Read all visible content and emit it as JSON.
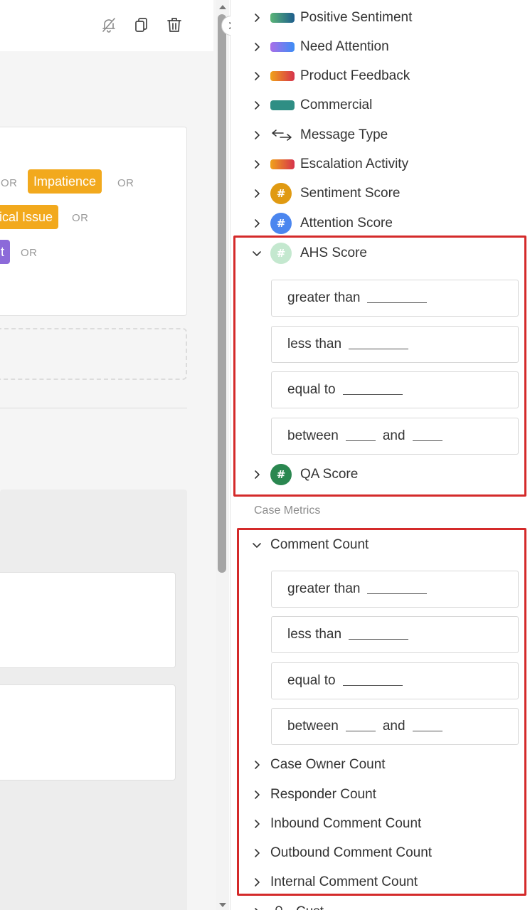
{
  "left": {
    "chips": {
      "impatience": "Impatience",
      "technical_issue": "ical Issue",
      "purple_partial": "t"
    },
    "or_label": "OR"
  },
  "attributes": [
    {
      "label": "Positive Sentiment",
      "indicator": "gradient-swatch",
      "colors": [
        "#5bb577",
        "#1d5d8c"
      ]
    },
    {
      "label": "Need Attention",
      "indicator": "gradient-swatch",
      "colors": [
        "#a96ee8",
        "#3d8df5"
      ]
    },
    {
      "label": "Product Feedback",
      "indicator": "gradient-swatch",
      "colors": [
        "#f0a21a",
        "#d6334c"
      ]
    },
    {
      "label": "Commercial",
      "indicator": "solid-swatch",
      "colors": [
        "#2f8e84",
        "#2f8e84"
      ]
    },
    {
      "label": "Message Type",
      "indicator": "arrows-icon"
    },
    {
      "label": "Escalation Activity",
      "indicator": "gradient-swatch",
      "colors": [
        "#f0a21a",
        "#d6334c"
      ]
    },
    {
      "label": "Sentiment Score",
      "indicator": "hash-badge",
      "color": "#e09a12"
    },
    {
      "label": "Attention Score",
      "indicator": "hash-badge",
      "color": "#4b86ef"
    },
    {
      "label": "AHS Score",
      "indicator": "hash-badge",
      "color": "#c4e8cf",
      "expanded": true
    },
    {
      "label": "QA Score",
      "indicator": "hash-badge",
      "color": "#2a8750"
    }
  ],
  "operators": {
    "greater_than": "greater than",
    "less_than": "less than",
    "equal_to": "equal to",
    "between": "between",
    "and": "and"
  },
  "case_metrics": {
    "label": "Case Metrics",
    "items": [
      {
        "label": "Comment Count",
        "expanded": true
      },
      {
        "label": "Case Owner Count"
      },
      {
        "label": "Responder Count"
      },
      {
        "label": "Inbound Comment Count"
      },
      {
        "label": "Outbound Comment Count"
      },
      {
        "label": "Internal Comment Count"
      },
      {
        "label": "Cust"
      }
    ]
  },
  "highlight_color": "#d42a2a"
}
